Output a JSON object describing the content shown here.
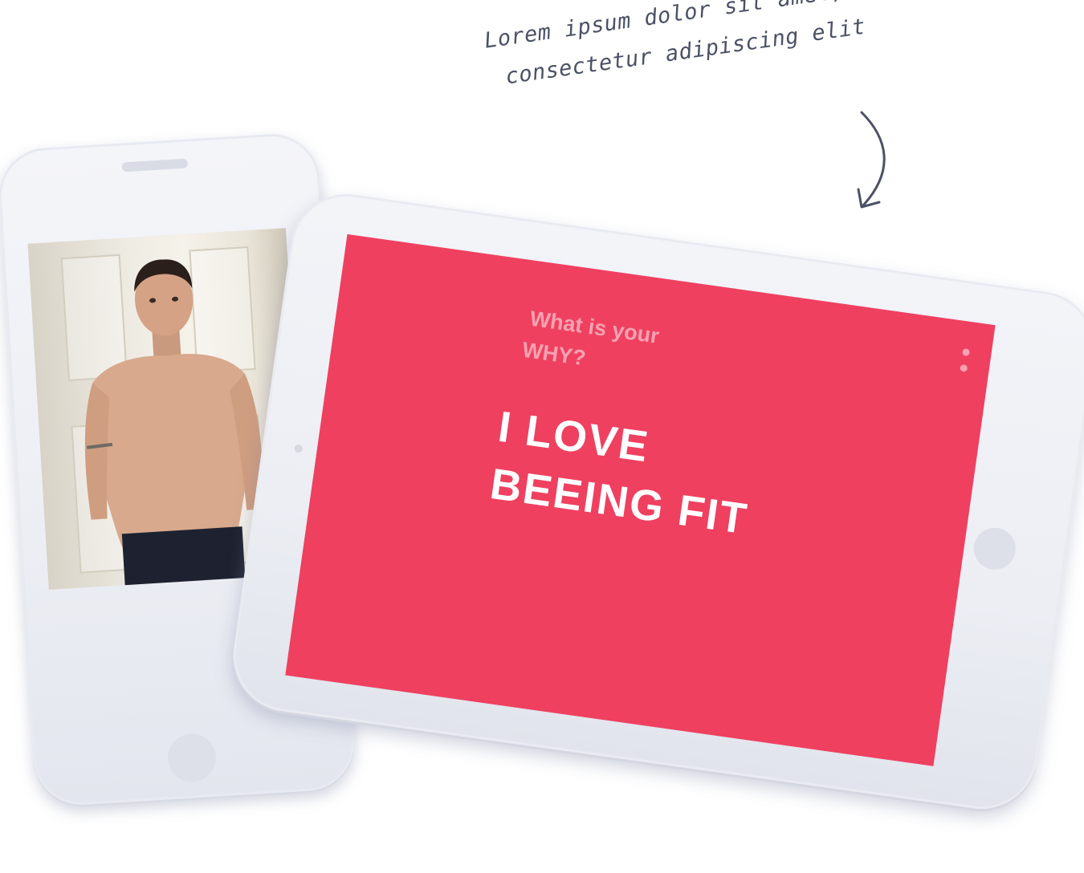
{
  "annotation": {
    "line1": "Lorem ipsum dolor sit amet,",
    "line2": "consectetur adipiscing elit"
  },
  "tablet": {
    "question_line1": "What is your",
    "question_line2": "WHY?",
    "answer_line1": "I LOVE",
    "answer_line2": "BEEING FIT",
    "menu_icon": "more-vertical-icon",
    "screen_color": "#ef4060",
    "accent_text_color": "#f7a1b1"
  },
  "phone": {
    "photo": "man-portrait-photo"
  }
}
